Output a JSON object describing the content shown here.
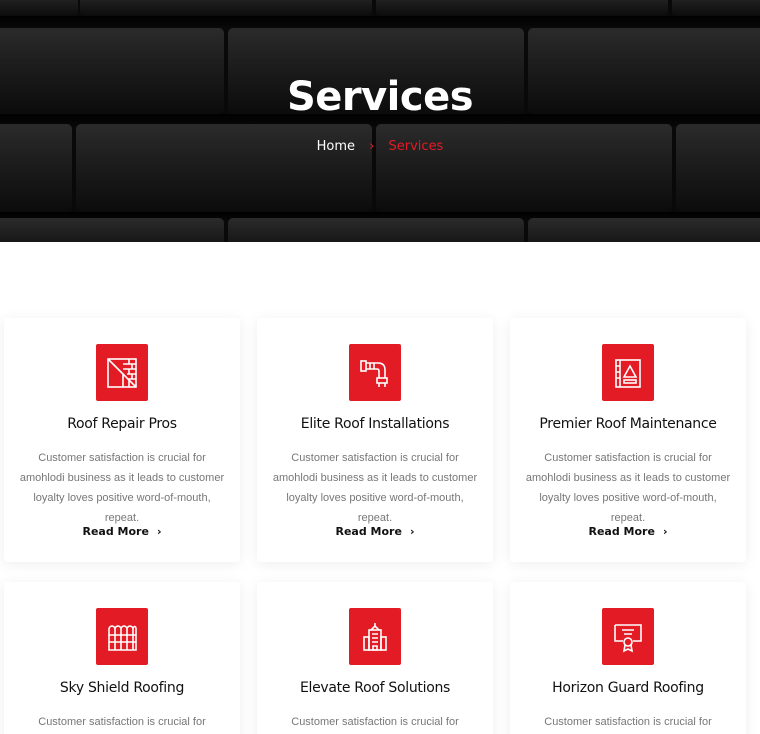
{
  "hero": {
    "title": "Services",
    "breadcrumb": {
      "home": "Home",
      "separator": "›",
      "current": "Services"
    }
  },
  "colors": {
    "accent": "#e31b25",
    "hero_bg": "#141414"
  },
  "services": [
    {
      "title": "Roof Repair Pros",
      "icon": "brick-wall-icon",
      "description": "Customer satisfaction is crucial for amohlodi business as it leads to customer loyalty loves positive word-of-mouth, repeat.",
      "link": "Read More"
    },
    {
      "title": "Elite Roof Installations",
      "icon": "pipe-icon",
      "description": "Customer satisfaction is crucial for amohlodi business as it leads to customer loyalty loves positive word-of-mouth, repeat.",
      "link": "Read More"
    },
    {
      "title": "Premier Roof Maintenance",
      "icon": "roof-panel-icon",
      "description": "Customer satisfaction is crucial for amohlodi business as it leads to customer loyalty loves positive word-of-mouth, repeat.",
      "link": "Read More"
    },
    {
      "title": "Sky Shield Roofing",
      "icon": "roof-tiles-icon",
      "description": "Customer satisfaction is crucial for amohlodi",
      "link": ""
    },
    {
      "title": "Elevate Roof Solutions",
      "icon": "building-icon",
      "description": "Customer satisfaction is crucial for amohlodi",
      "link": ""
    },
    {
      "title": "Horizon Guard Roofing",
      "icon": "certificate-icon",
      "description": "Customer satisfaction is crucial for amohlodi",
      "link": ""
    }
  ]
}
